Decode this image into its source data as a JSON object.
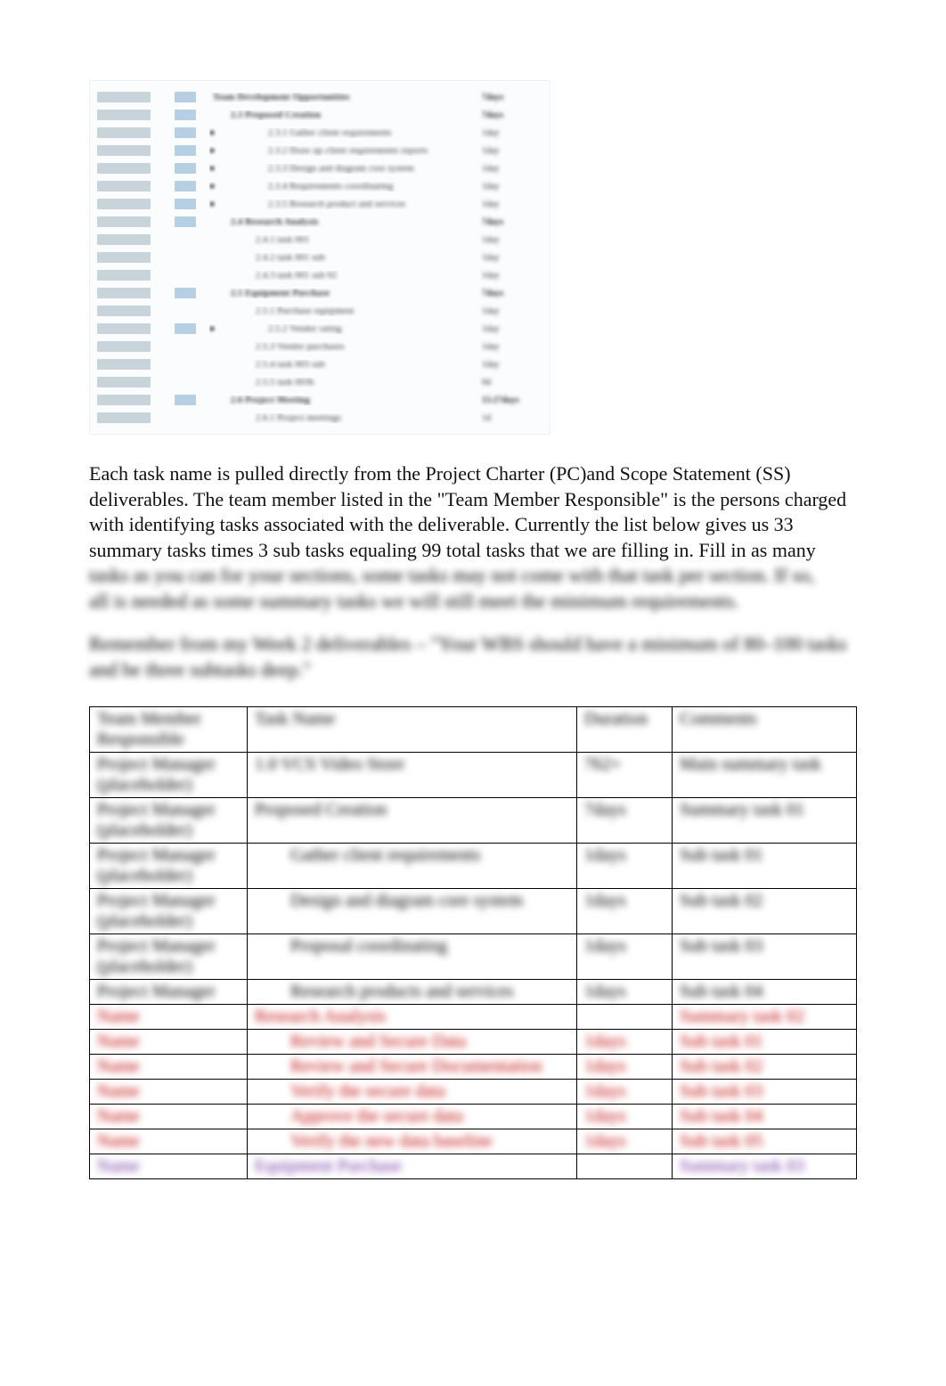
{
  "screenshot_wbs": {
    "rows": [
      {
        "level": 1,
        "label": "Team Development Opportunities",
        "right": "7days",
        "aBar": true,
        "bBar": true
      },
      {
        "level": 2,
        "label": "2.3 Proposed Creation",
        "right": "7days",
        "aBar": true,
        "bBar": true
      },
      {
        "level": 3,
        "label": "2.3.1 Gather client requirements",
        "right": "1day",
        "aBar": true,
        "bBar": true,
        "dot": true
      },
      {
        "level": 3,
        "label": "2.3.2 Draw up client requirements reports",
        "right": "1day",
        "aBar": true,
        "bBar": true,
        "dot": true
      },
      {
        "level": 3,
        "label": "2.3.3 Design and diagram core system",
        "right": "1day",
        "aBar": true,
        "bBar": true,
        "dot": true
      },
      {
        "level": 3,
        "label": "2.3.4 Requirements coordinating",
        "right": "1day",
        "aBar": true,
        "bBar": true,
        "dot": true
      },
      {
        "level": 3,
        "label": "2.3.5 Research product and services",
        "right": "1day",
        "aBar": true,
        "bBar": true,
        "dot": true
      },
      {
        "level": 2,
        "label": "2.4 Research Analysis",
        "right": "7days",
        "aBar": true,
        "bBar": true
      },
      {
        "level": 3,
        "label": "2.4.1 task 001",
        "right": "1day",
        "aBar": true,
        "bBar": false
      },
      {
        "level": 3,
        "label": "2.4.2 task 001 sub",
        "right": "1day",
        "aBar": true,
        "bBar": false
      },
      {
        "level": 3,
        "label": "2.4.3 task 001 sub 02",
        "right": "1day",
        "aBar": true,
        "bBar": false
      },
      {
        "level": 2,
        "label": "2.5 Equipment Purchase",
        "right": "7days",
        "aBar": true,
        "bBar": true
      },
      {
        "level": 3,
        "label": "2.5.1 Purchase equipment",
        "right": "1day",
        "aBar": true,
        "bBar": false
      },
      {
        "level": 3,
        "label": "2.5.2 Vendor rating",
        "right": "1day",
        "aBar": true,
        "bBar": true,
        "dot": true
      },
      {
        "level": 3,
        "label": "2.5.3 Vendor purchases",
        "right": "1day",
        "aBar": true,
        "bBar": false
      },
      {
        "level": 3,
        "label": "2.5.4 task 003 sub",
        "right": "1day",
        "aBar": true,
        "bBar": false
      },
      {
        "level": 3,
        "label": "2.5.5 task 003b",
        "right": "0d",
        "aBar": true,
        "bBar": false
      },
      {
        "level": 2,
        "label": "2.6 Project Meeting",
        "right": "13.17days",
        "aBar": true,
        "bBar": true
      },
      {
        "level": 3,
        "label": "2.6.1 Project meetings",
        "right": "1d",
        "aBar": true,
        "bBar": false
      }
    ]
  },
  "paragraph_main": {
    "l1": "Each task name is pulled directly from the Project Charter (PC)and Scope Statement (SS)",
    "l2": "deliverables.  The team member listed in the \"Team Member Responsible\" is the persons charged",
    "l3": "with identifying tasks associated with the deliverable.  Currently the list below gives us 33",
    "l4": "summary tasks times 3 sub tasks equaling 99 total tasks that we are filling in.  Fill in as many",
    "blurred1": "tasks as you can for your sections, some tasks may not come with that task per section. If so,",
    "blurred2": "all is needed as some summary tasks we will still meet the minimum requirements."
  },
  "note_block": {
    "lead": "Remember from my Week 2 deliverables – ",
    "rest": "\"Your WBS should have a minimum of 80–100 tasks and be three subtasks deep.\""
  },
  "assign_table": {
    "headers": [
      "Team Member Responsible",
      "Task Name",
      "Duration",
      "Comments"
    ],
    "rows": [
      {
        "color": "#000000",
        "cells": [
          "Project Manager (placeholder)",
          "1.0 VCS Video Store",
          "",
          "762+",
          "Main summary task"
        ]
      },
      {
        "color": "#000000",
        "cells": [
          "Project Manager (placeholder)",
          "Proposed Creation",
          "",
          "7days",
          "Summary task 01"
        ]
      },
      {
        "color": "#000000",
        "cells": [
          "Project Manager (placeholder)",
          "Gather client requirements",
          "task-indent",
          "1days",
          "Sub task 01"
        ]
      },
      {
        "color": "#000000",
        "cells": [
          "Project Manager (placeholder)",
          "Design and diagram core system",
          "task-indent",
          "1days",
          "Sub task 02"
        ]
      },
      {
        "color": "#000000",
        "cells": [
          "Project Manager (placeholder)",
          "Proposal coordinating",
          "task-indent",
          "1days",
          "Sub task 03"
        ]
      },
      {
        "color": "#000000",
        "cells": [
          "Project Manager",
          "Research products and services",
          "task-indent",
          "1days",
          "Sub task 04"
        ]
      },
      {
        "color": "#c00000",
        "cells": [
          "Name",
          "Research Analysis",
          "",
          "",
          "Summary task 02"
        ]
      },
      {
        "color": "#c00000",
        "cells": [
          "Name",
          "Review and Secure Data",
          "task-indent",
          "1days",
          "Sub task 01"
        ]
      },
      {
        "color": "#c00000",
        "cells": [
          "Name",
          "Review and Secure Documentation",
          "task-indent",
          "1days",
          "Sub task 02"
        ]
      },
      {
        "color": "#c00000",
        "cells": [
          "Name",
          "Verify the secure data",
          "task-indent",
          "1days",
          "Sub task 03"
        ]
      },
      {
        "color": "#c00000",
        "cells": [
          "Name",
          "Approve the secure data",
          "task-indent",
          "1days",
          "Sub task 04"
        ]
      },
      {
        "color": "#c00000",
        "cells": [
          "Name",
          "Verify the new data baseline",
          "task-indent",
          "1days",
          "Sub task 05"
        ]
      },
      {
        "color": "#7030a0",
        "cells": [
          "Name",
          "Equipment Purchase",
          "",
          "",
          "Summary task 03"
        ]
      }
    ]
  }
}
